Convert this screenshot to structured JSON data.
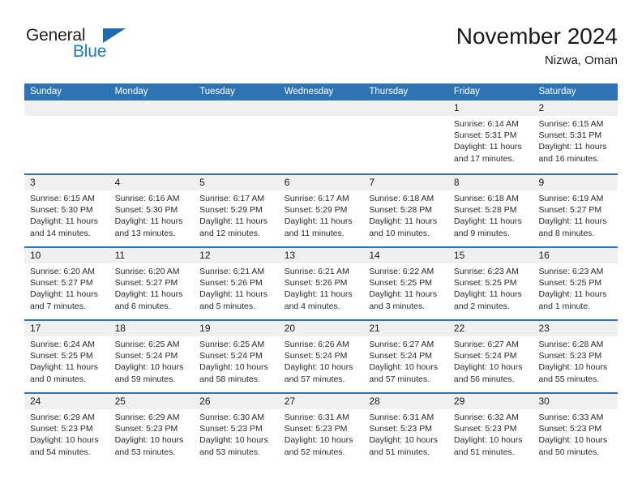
{
  "brand": {
    "name_part1": "General",
    "name_part2": "Blue",
    "logo_icon": "triangle-flag-icon"
  },
  "header": {
    "title": "November 2024",
    "subtitle": "Nizwa, Oman"
  },
  "colors": {
    "header_blue": "#2e74b5",
    "brand_blue": "#1b79c3",
    "daynum_band": "#f0f0f0",
    "text": "#1a1a1a"
  },
  "calendar": {
    "weekday_headers": [
      "Sunday",
      "Monday",
      "Tuesday",
      "Wednesday",
      "Thursday",
      "Friday",
      "Saturday"
    ],
    "weeks": [
      [
        {
          "day": "",
          "empty": true
        },
        {
          "day": "",
          "empty": true
        },
        {
          "day": "",
          "empty": true
        },
        {
          "day": "",
          "empty": true
        },
        {
          "day": "",
          "empty": true
        },
        {
          "day": "1",
          "sunrise": "Sunrise: 6:14 AM",
          "sunset": "Sunset: 5:31 PM",
          "daylight": "Daylight: 11 hours and 17 minutes."
        },
        {
          "day": "2",
          "sunrise": "Sunrise: 6:15 AM",
          "sunset": "Sunset: 5:31 PM",
          "daylight": "Daylight: 11 hours and 16 minutes."
        }
      ],
      [
        {
          "day": "3",
          "sunrise": "Sunrise: 6:15 AM",
          "sunset": "Sunset: 5:30 PM",
          "daylight": "Daylight: 11 hours and 14 minutes."
        },
        {
          "day": "4",
          "sunrise": "Sunrise: 6:16 AM",
          "sunset": "Sunset: 5:30 PM",
          "daylight": "Daylight: 11 hours and 13 minutes."
        },
        {
          "day": "5",
          "sunrise": "Sunrise: 6:17 AM",
          "sunset": "Sunset: 5:29 PM",
          "daylight": "Daylight: 11 hours and 12 minutes."
        },
        {
          "day": "6",
          "sunrise": "Sunrise: 6:17 AM",
          "sunset": "Sunset: 5:29 PM",
          "daylight": "Daylight: 11 hours and 11 minutes."
        },
        {
          "day": "7",
          "sunrise": "Sunrise: 6:18 AM",
          "sunset": "Sunset: 5:28 PM",
          "daylight": "Daylight: 11 hours and 10 minutes."
        },
        {
          "day": "8",
          "sunrise": "Sunrise: 6:18 AM",
          "sunset": "Sunset: 5:28 PM",
          "daylight": "Daylight: 11 hours and 9 minutes."
        },
        {
          "day": "9",
          "sunrise": "Sunrise: 6:19 AM",
          "sunset": "Sunset: 5:27 PM",
          "daylight": "Daylight: 11 hours and 8 minutes."
        }
      ],
      [
        {
          "day": "10",
          "sunrise": "Sunrise: 6:20 AM",
          "sunset": "Sunset: 5:27 PM",
          "daylight": "Daylight: 11 hours and 7 minutes."
        },
        {
          "day": "11",
          "sunrise": "Sunrise: 6:20 AM",
          "sunset": "Sunset: 5:27 PM",
          "daylight": "Daylight: 11 hours and 6 minutes."
        },
        {
          "day": "12",
          "sunrise": "Sunrise: 6:21 AM",
          "sunset": "Sunset: 5:26 PM",
          "daylight": "Daylight: 11 hours and 5 minutes."
        },
        {
          "day": "13",
          "sunrise": "Sunrise: 6:21 AM",
          "sunset": "Sunset: 5:26 PM",
          "daylight": "Daylight: 11 hours and 4 minutes."
        },
        {
          "day": "14",
          "sunrise": "Sunrise: 6:22 AM",
          "sunset": "Sunset: 5:25 PM",
          "daylight": "Daylight: 11 hours and 3 minutes."
        },
        {
          "day": "15",
          "sunrise": "Sunrise: 6:23 AM",
          "sunset": "Sunset: 5:25 PM",
          "daylight": "Daylight: 11 hours and 2 minutes."
        },
        {
          "day": "16",
          "sunrise": "Sunrise: 6:23 AM",
          "sunset": "Sunset: 5:25 PM",
          "daylight": "Daylight: 11 hours and 1 minute."
        }
      ],
      [
        {
          "day": "17",
          "sunrise": "Sunrise: 6:24 AM",
          "sunset": "Sunset: 5:25 PM",
          "daylight": "Daylight: 11 hours and 0 minutes."
        },
        {
          "day": "18",
          "sunrise": "Sunrise: 6:25 AM",
          "sunset": "Sunset: 5:24 PM",
          "daylight": "Daylight: 10 hours and 59 minutes."
        },
        {
          "day": "19",
          "sunrise": "Sunrise: 6:25 AM",
          "sunset": "Sunset: 5:24 PM",
          "daylight": "Daylight: 10 hours and 58 minutes."
        },
        {
          "day": "20",
          "sunrise": "Sunrise: 6:26 AM",
          "sunset": "Sunset: 5:24 PM",
          "daylight": "Daylight: 10 hours and 57 minutes."
        },
        {
          "day": "21",
          "sunrise": "Sunrise: 6:27 AM",
          "sunset": "Sunset: 5:24 PM",
          "daylight": "Daylight: 10 hours and 57 minutes."
        },
        {
          "day": "22",
          "sunrise": "Sunrise: 6:27 AM",
          "sunset": "Sunset: 5:24 PM",
          "daylight": "Daylight: 10 hours and 56 minutes."
        },
        {
          "day": "23",
          "sunrise": "Sunrise: 6:28 AM",
          "sunset": "Sunset: 5:23 PM",
          "daylight": "Daylight: 10 hours and 55 minutes."
        }
      ],
      [
        {
          "day": "24",
          "sunrise": "Sunrise: 6:29 AM",
          "sunset": "Sunset: 5:23 PM",
          "daylight": "Daylight: 10 hours and 54 minutes."
        },
        {
          "day": "25",
          "sunrise": "Sunrise: 6:29 AM",
          "sunset": "Sunset: 5:23 PM",
          "daylight": "Daylight: 10 hours and 53 minutes."
        },
        {
          "day": "26",
          "sunrise": "Sunrise: 6:30 AM",
          "sunset": "Sunset: 5:23 PM",
          "daylight": "Daylight: 10 hours and 53 minutes."
        },
        {
          "day": "27",
          "sunrise": "Sunrise: 6:31 AM",
          "sunset": "Sunset: 5:23 PM",
          "daylight": "Daylight: 10 hours and 52 minutes."
        },
        {
          "day": "28",
          "sunrise": "Sunrise: 6:31 AM",
          "sunset": "Sunset: 5:23 PM",
          "daylight": "Daylight: 10 hours and 51 minutes."
        },
        {
          "day": "29",
          "sunrise": "Sunrise: 6:32 AM",
          "sunset": "Sunset: 5:23 PM",
          "daylight": "Daylight: 10 hours and 51 minutes."
        },
        {
          "day": "30",
          "sunrise": "Sunrise: 6:33 AM",
          "sunset": "Sunset: 5:23 PM",
          "daylight": "Daylight: 10 hours and 50 minutes."
        }
      ]
    ]
  }
}
